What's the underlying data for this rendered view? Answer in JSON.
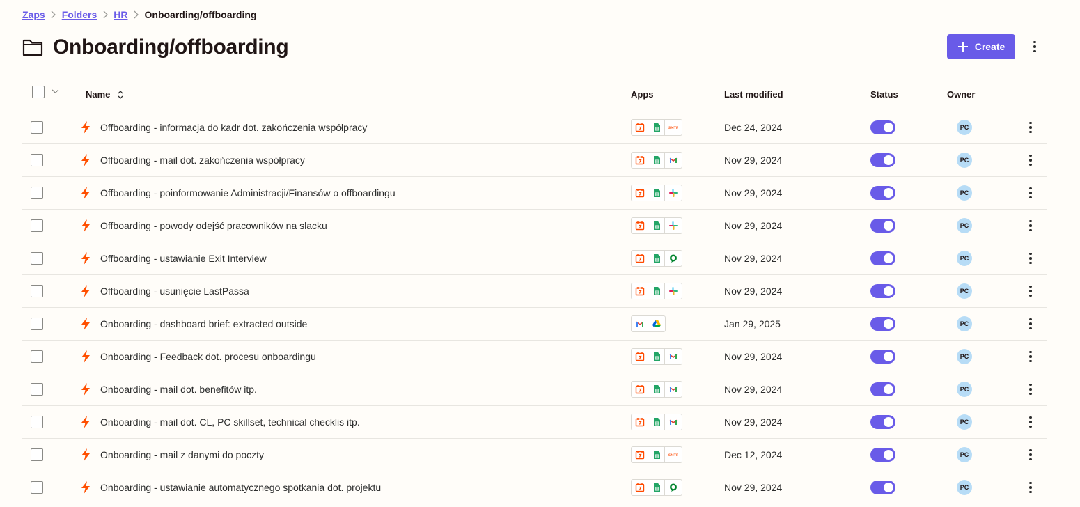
{
  "breadcrumb": {
    "items": [
      "Zaps",
      "Folders",
      "HR"
    ],
    "current": "Onboarding/offboarding"
  },
  "page": {
    "title": "Onboarding/offboarding",
    "create_label": "Create"
  },
  "table": {
    "headers": {
      "name": "Name",
      "apps": "Apps",
      "last_modified": "Last modified",
      "status": "Status",
      "owner": "Owner"
    },
    "rows": [
      {
        "name": "Offboarding - informacja do kadr dot. zakończenia współpracy",
        "apps": [
          "schedule",
          "sheets",
          "smtp"
        ],
        "modified": "Dec 24, 2024",
        "status_on": true,
        "owner": "PC"
      },
      {
        "name": "Offboarding - mail dot. zakończenia współpracy",
        "apps": [
          "schedule",
          "sheets",
          "gmail"
        ],
        "modified": "Nov 29, 2024",
        "status_on": true,
        "owner": "PC"
      },
      {
        "name": "Offboarding - poinformowanie Administracji/Finansów o offboardingu",
        "apps": [
          "schedule",
          "sheets",
          "slack"
        ],
        "modified": "Nov 29, 2024",
        "status_on": true,
        "owner": "PC"
      },
      {
        "name": "Offboarding - powody odejść pracowników na slacku",
        "apps": [
          "schedule",
          "sheets",
          "slack"
        ],
        "modified": "Nov 29, 2024",
        "status_on": true,
        "owner": "PC"
      },
      {
        "name": "Offboarding - ustawianie Exit Interview",
        "apps": [
          "schedule",
          "sheets",
          "google-meet"
        ],
        "modified": "Nov 29, 2024",
        "status_on": true,
        "owner": "PC"
      },
      {
        "name": "Offboarding - usunięcie LastPassa",
        "apps": [
          "schedule",
          "sheets",
          "slack"
        ],
        "modified": "Nov 29, 2024",
        "status_on": true,
        "owner": "PC"
      },
      {
        "name": "Onboarding - dashboard brief: extracted outside",
        "apps": [
          "gmail",
          "google-drive"
        ],
        "modified": "Jan 29, 2025",
        "status_on": true,
        "owner": "PC"
      },
      {
        "name": "Onboarding - Feedback dot. procesu onboardingu",
        "apps": [
          "schedule",
          "sheets",
          "gmail"
        ],
        "modified": "Nov 29, 2024",
        "status_on": true,
        "owner": "PC"
      },
      {
        "name": "Onboarding - mail dot. benefitów itp.",
        "apps": [
          "schedule",
          "sheets",
          "gmail"
        ],
        "modified": "Nov 29, 2024",
        "status_on": true,
        "owner": "PC"
      },
      {
        "name": "Onboarding - mail dot. CL, PC skillset, technical checklis itp.",
        "apps": [
          "schedule",
          "sheets",
          "gmail"
        ],
        "modified": "Nov 29, 2024",
        "status_on": true,
        "owner": "PC"
      },
      {
        "name": "Onboarding - mail z danymi do poczty",
        "apps": [
          "schedule",
          "sheets",
          "smtp"
        ],
        "modified": "Dec 12, 2024",
        "status_on": true,
        "owner": "PC"
      },
      {
        "name": "Onboarding - ustawianie automatycznego spotkania dot. projektu",
        "apps": [
          "schedule",
          "sheets",
          "google-meet"
        ],
        "modified": "Nov 29, 2024",
        "status_on": true,
        "owner": "PC"
      }
    ]
  },
  "colors": {
    "accent": "#695be8",
    "zap_bolt": "#ff4f00",
    "avatar_bg": "#b7dcf6"
  }
}
